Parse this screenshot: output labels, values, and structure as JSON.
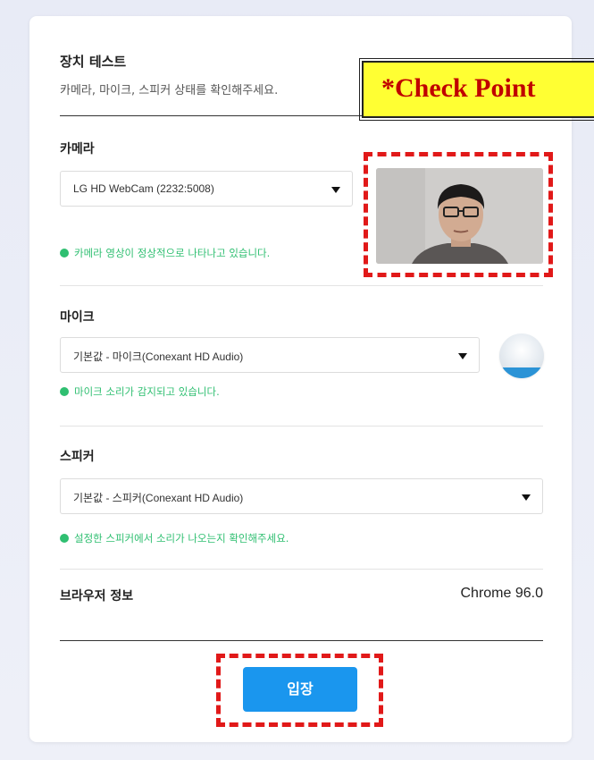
{
  "device_test": {
    "title": "장치 테스트",
    "subtitle": "카메라, 마이크, 스피커 상태를 확인해주세요."
  },
  "check_point": {
    "label": "*Check Point"
  },
  "camera": {
    "label": "카메라",
    "selected": "LG HD WebCam (2232:5008)",
    "status": "카메라 영상이 정상적으로 나타나고 있습니다."
  },
  "mic": {
    "label": "마이크",
    "selected": "기본값 - 마이크(Conexant HD Audio)",
    "status": "마이크 소리가 감지되고 있습니다.",
    "level": 0.24
  },
  "speaker": {
    "label": "스피커",
    "selected": "기본값 - 스피커(Conexant HD Audio)",
    "status": "설정한 스피커에서 소리가 나오는지 확인해주세요."
  },
  "browser": {
    "label": "브라우저 정보",
    "value": "Chrome 96.0"
  },
  "enter_button": {
    "label": "입장"
  },
  "colors": {
    "accent": "#1a96ee",
    "status_green": "#2fbf71",
    "highlight_red": "#e11919",
    "callout_yellow": "#ffff33"
  },
  "icons": {
    "status": "status-dot-icon",
    "dropdown": "chevron-down-icon",
    "mic_level": "mic-level-icon"
  }
}
